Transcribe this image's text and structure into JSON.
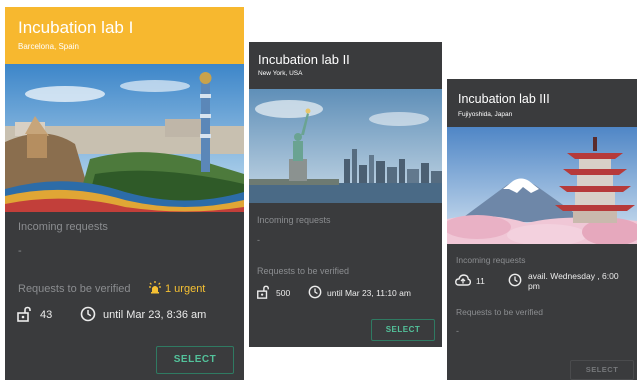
{
  "cards": [
    {
      "title": "Incubation lab I",
      "subtitle": "Barcelona, Spain",
      "incoming_label": "Incoming requests",
      "incoming_value": "-",
      "verify_label": "Requests to be verified",
      "urgent_text": "1 urgent",
      "count": "43",
      "deadline": "until Mar 23, 8:36 am",
      "button": "SELECT",
      "header_color": "#f7b82f"
    },
    {
      "title": "Incubation lab II",
      "subtitle": "New York, USA",
      "incoming_label": "Incoming requests",
      "incoming_value": "-",
      "verify_label": "Requests to be verified",
      "count": "500",
      "deadline": "until Mar 23, 11:10 am",
      "button": "SELECT"
    },
    {
      "title": "Incubation lab III",
      "subtitle": "Fujiyoshida, Japan",
      "incoming_label": "Incoming requests",
      "count": "11",
      "availability": "avail. Wednesday , 6:00 pm",
      "verify_label": "Requests to be verified",
      "verify_value": "-",
      "button": "SELECT"
    }
  ],
  "icons": {
    "lock": "unlock-icon",
    "clock": "clock-icon",
    "urgent": "lamp-icon",
    "cloud": "cloud-upload-icon"
  },
  "colors": {
    "card_bg": "#3a3b3d",
    "accent": "#53c29b",
    "urgent": "#f5c033",
    "muted_text": "#8b8d90"
  }
}
